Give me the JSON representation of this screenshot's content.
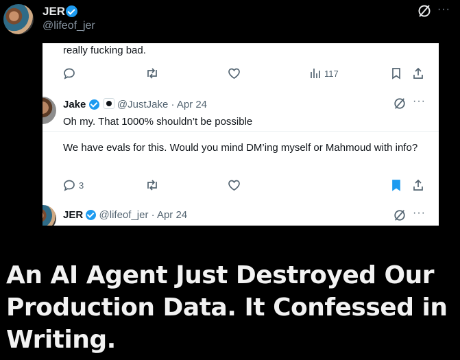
{
  "header": {
    "name": "JER",
    "handle": "@lifeof_jer"
  },
  "card": {
    "first_tweet_tail": "really fucking bad.",
    "first_actions": {
      "views": "117"
    },
    "reply": {
      "name": "Jake",
      "handle_date": "@JustJake · Apr 24",
      "line1": "Oh my. That 1000% shouldn’t be possible",
      "line2": "We have evals for this. Would you mind DM’ing myself or Mahmoud with info?",
      "reply_count": "3"
    },
    "third": {
      "name": "JER",
      "handle_date": "@lifeof_jer · Apr 24"
    }
  },
  "headline": {
    "text": "An AI Agent Just Destroyed Our Production Data. It Confessed in Writing."
  },
  "colors": {
    "verified": "#1d9bf0",
    "bookmark_active": "#1d9bf0",
    "background": "#000000"
  }
}
